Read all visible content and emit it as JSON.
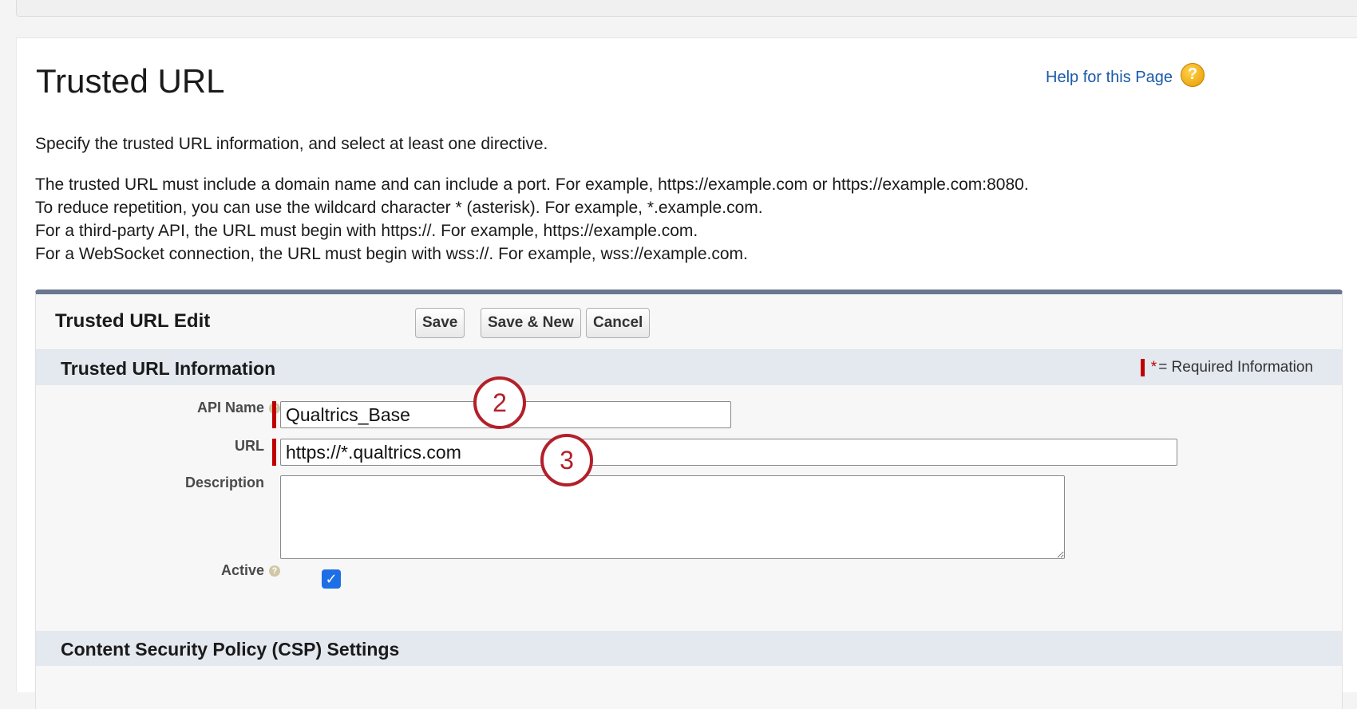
{
  "page": {
    "title": "Trusted URL",
    "help_link": "Help for this Page",
    "help_icon": "help-question-icon",
    "intro_line_1": "Specify the trusted URL information, and select at least one directive.",
    "intro_lines": [
      "The trusted URL must include a domain name and can include a port. For example, https://example.com or https://example.com:8080.",
      "To reduce repetition, you can use the wildcard character * (asterisk). For example, *.example.com.",
      "For a third-party API, the URL must begin with https://. For example, https://example.com.",
      "For a WebSocket connection, the URL must begin with wss://. For example, wss://example.com."
    ]
  },
  "edit_panel": {
    "title": "Trusted URL Edit",
    "buttons": {
      "save": "Save",
      "save_new": "Save & New",
      "cancel": "Cancel"
    },
    "section_info": {
      "title": "Trusted URL Information",
      "required_star": "*",
      "required_text": "= Required Information"
    },
    "fields": {
      "api_name_label": "API Name",
      "api_name_value": "Qualtrics_Base",
      "url_label": "URL",
      "url_value": "https://*.qualtrics.com",
      "description_label": "Description",
      "description_value": "",
      "active_label": "Active",
      "active_checked": true
    },
    "section_csp": {
      "title": "Content Security Policy (CSP) Settings"
    }
  },
  "callouts": {
    "step_2": "2",
    "step_3": "3"
  },
  "colors": {
    "link": "#1a5aa8",
    "required": "#c00000",
    "callout": "#b3202a",
    "checkbox": "#1e6fe6",
    "panel_border": "#6a7690"
  }
}
